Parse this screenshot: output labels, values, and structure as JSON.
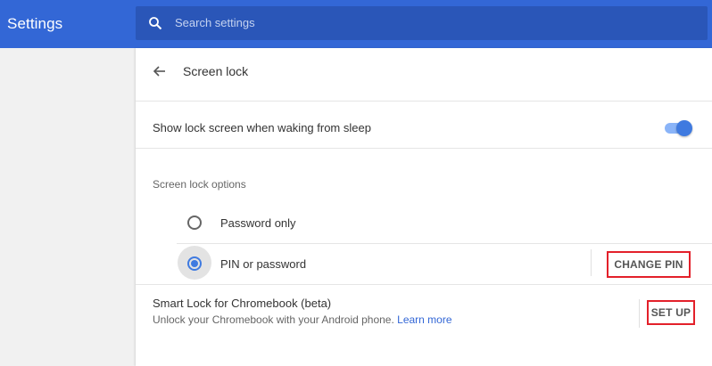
{
  "header": {
    "app_title": "Settings",
    "search_placeholder": "Search settings",
    "color": "#3367d6"
  },
  "page": {
    "title": "Screen lock",
    "back_icon": "arrow-left-icon"
  },
  "toggle": {
    "label": "Show lock screen when waking from sleep",
    "state": "on",
    "accent": "#3f7ae0"
  },
  "options": {
    "section_label": "Screen lock options",
    "items": [
      {
        "label": "Password only",
        "checked": false
      },
      {
        "label": "PIN or password",
        "checked": true
      }
    ],
    "change_pin_label": "CHANGE PIN"
  },
  "smart_lock": {
    "title": "Smart Lock for Chromebook (beta)",
    "description": "Unlock your Chromebook with your Android phone.",
    "learn_more": "Learn more",
    "set_up_label": "SET UP"
  },
  "annotation_color": "#e3202a"
}
